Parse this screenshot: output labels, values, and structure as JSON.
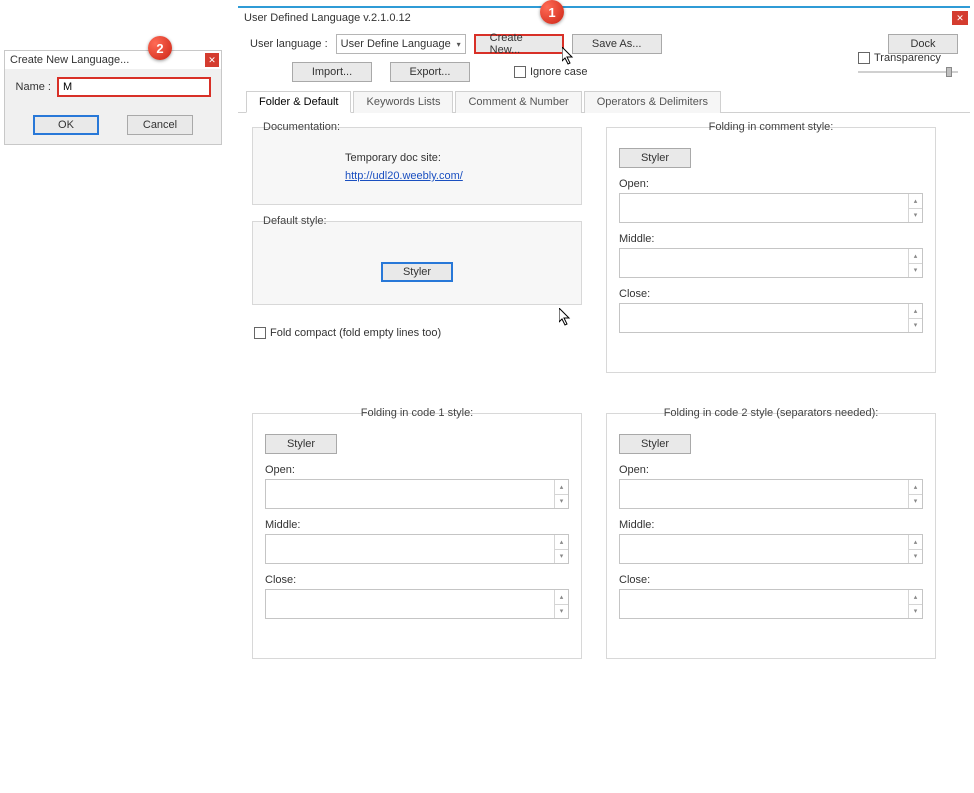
{
  "dialog": {
    "title": "Create New Language...",
    "name_label": "Name :",
    "name_value": "M",
    "ok": "OK",
    "cancel": "Cancel"
  },
  "main": {
    "title": "User Defined Language v.2.1.0.12",
    "user_lang_label": "User language :",
    "user_lang_value": "User Define Language",
    "create_new": "Create New...",
    "save_as": "Save As...",
    "dock": "Dock",
    "import": "Import...",
    "export": "Export...",
    "ignore_case": "Ignore case",
    "transparency": "Transparency"
  },
  "tabs": {
    "folder": "Folder & Default",
    "keywords": "Keywords Lists",
    "comment": "Comment & Number",
    "operators": "Operators & Delimiters"
  },
  "doc": {
    "group_title": "Documentation:",
    "temp_label": "Temporary doc site:",
    "url": "http://udl20.weebly.com/"
  },
  "default_style": {
    "group_title": "Default style:",
    "styler": "Styler"
  },
  "fold_compact": "Fold compact (fold empty lines too)",
  "folding_comment": {
    "group_title": "Folding in comment style:",
    "styler": "Styler",
    "open": "Open:",
    "middle": "Middle:",
    "close": "Close:"
  },
  "folding_code1": {
    "group_title": "Folding in code 1 style:",
    "styler": "Styler",
    "open": "Open:",
    "middle": "Middle:",
    "close": "Close:"
  },
  "folding_code2": {
    "group_title": "Folding in code 2 style (separators needed):",
    "styler": "Styler",
    "open": "Open:",
    "middle": "Middle:",
    "close": "Close:"
  },
  "callouts": {
    "one": "1",
    "two": "2"
  }
}
